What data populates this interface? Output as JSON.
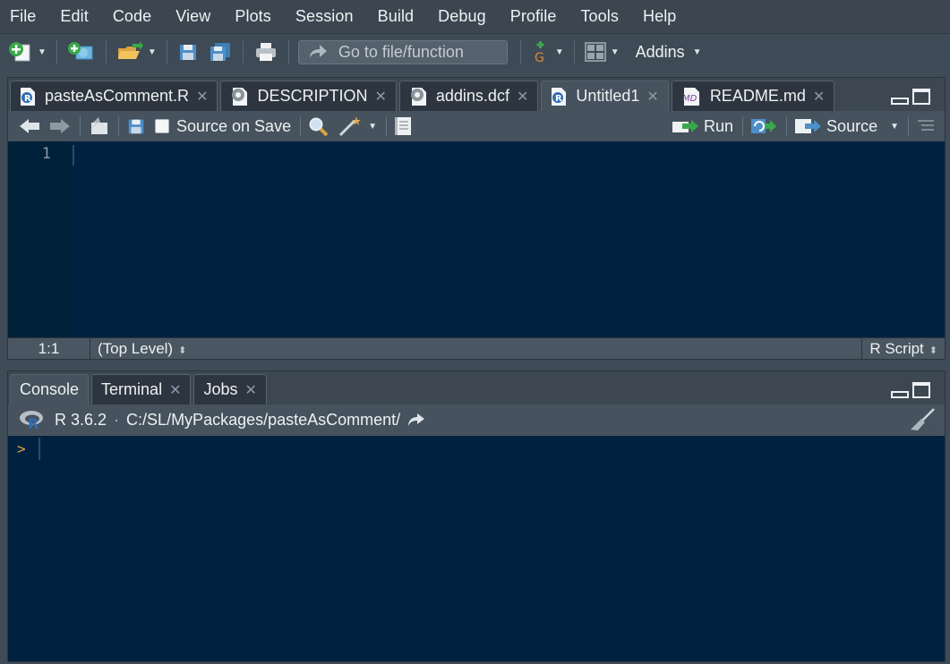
{
  "menubar": {
    "items": [
      "File",
      "Edit",
      "Code",
      "View",
      "Plots",
      "Session",
      "Build",
      "Debug",
      "Profile",
      "Tools",
      "Help"
    ]
  },
  "toolbar": {
    "goto_placeholder": "Go to file/function",
    "addins_label": "Addins"
  },
  "editor": {
    "tabs": [
      {
        "label": "pasteAsComment.R",
        "icon": "r-file-icon",
        "active": false
      },
      {
        "label": "DESCRIPTION",
        "icon": "gear-file-icon",
        "active": false
      },
      {
        "label": "addins.dcf",
        "icon": "gear-file-icon",
        "active": false
      },
      {
        "label": "Untitled1",
        "icon": "r-file-icon",
        "active": true
      },
      {
        "label": "README.md",
        "icon": "md-file-icon",
        "active": false
      }
    ],
    "source_on_save_label": "Source on Save",
    "run_label": "Run",
    "source_label": "Source",
    "line_numbers": [
      "1"
    ],
    "status": {
      "position": "1:1",
      "scope": "(Top Level)",
      "file_type": "R Script"
    }
  },
  "console": {
    "tabs": [
      {
        "label": "Console",
        "active": true
      },
      {
        "label": "Terminal",
        "active": false
      },
      {
        "label": "Jobs",
        "active": false
      }
    ],
    "r_version": "R 3.6.2",
    "separator": "·",
    "working_dir": "C:/SL/MyPackages/pasteAsComment/",
    "prompt": ">"
  },
  "colors": {
    "editor_background": "#002240",
    "chrome_background": "#3f4b57",
    "prompt_color": "#e6a44a"
  }
}
